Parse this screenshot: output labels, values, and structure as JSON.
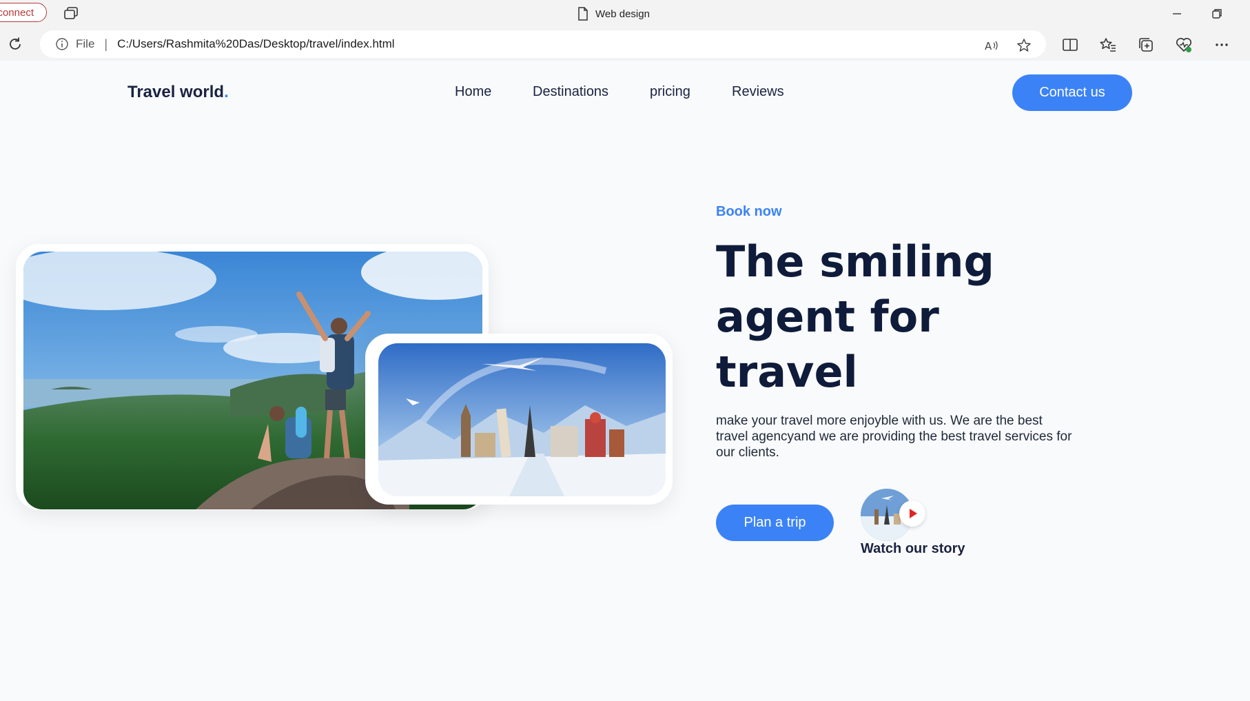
{
  "browser": {
    "connect_label": "connect",
    "tab_title": "Web design",
    "file_label": "File",
    "separator": "|",
    "url": "C:/Users/Rashmita%20Das/Desktop/travel/index.html"
  },
  "nav": {
    "logo": "Travel world",
    "logo_dot": ".",
    "items": [
      "Home",
      "Destinations",
      "pricing",
      "Reviews"
    ],
    "contact": "Contact us"
  },
  "hero": {
    "eyebrow": "Book now",
    "headline": [
      "The smiling",
      "agent for",
      "travel"
    ],
    "description": "make your travel more enjoyble with us. We are the best travel agencyand we are providing the best travel services for our clients.",
    "cta": "Plan a trip",
    "story_label": "Watch our story"
  },
  "colors": {
    "accent": "#3b82f6",
    "heading": "#0f1b3a",
    "background": "#f8fafc"
  }
}
